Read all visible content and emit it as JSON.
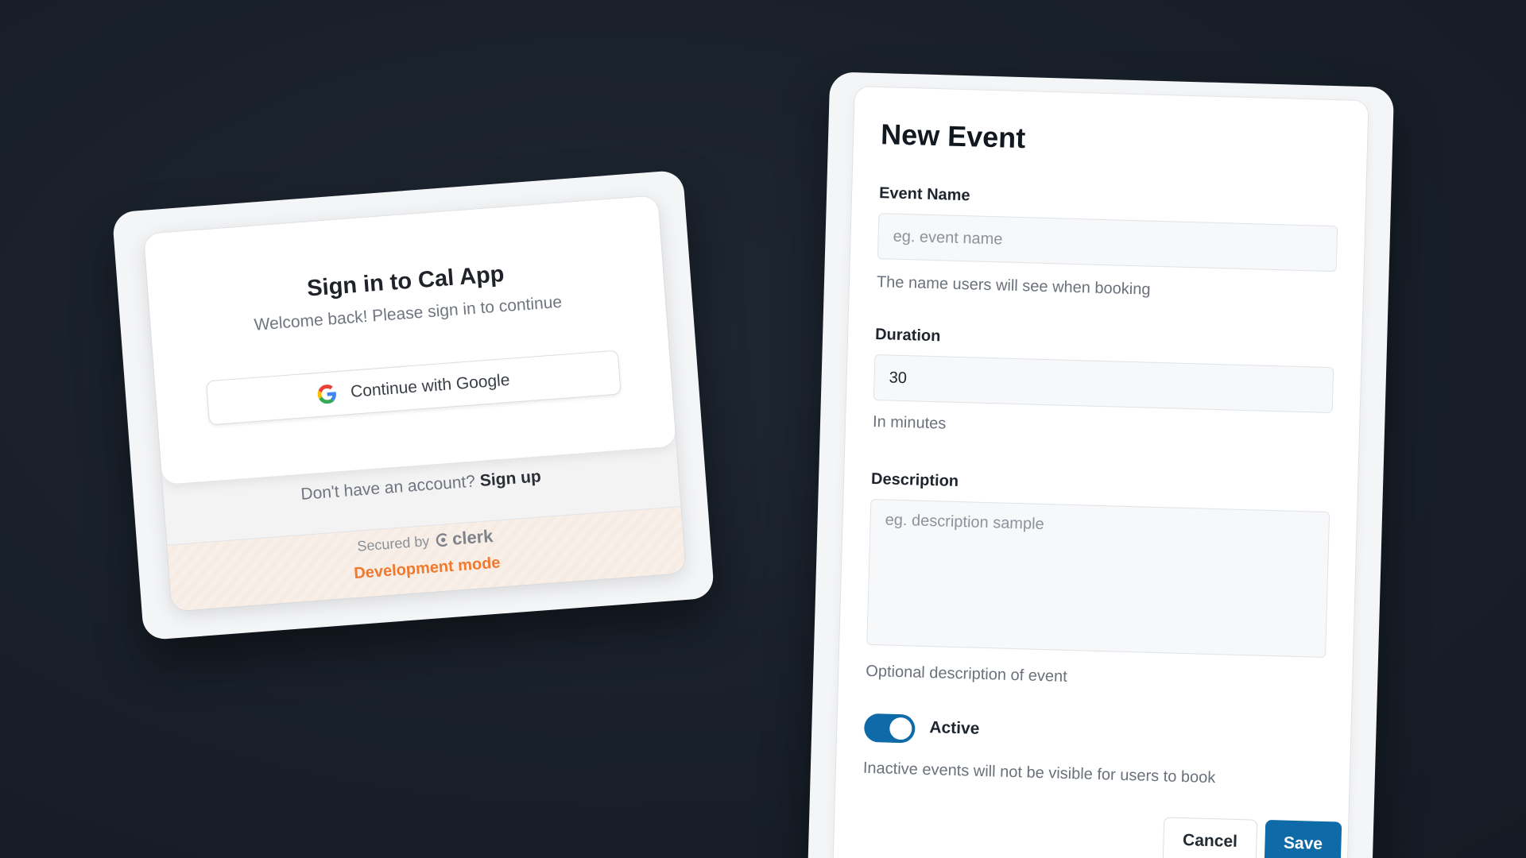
{
  "signin": {
    "title": "Sign in to Cal App",
    "subtitle": "Welcome back! Please sign in to continue",
    "google_button_label": "Continue with Google",
    "signup_prompt": "Don't have an account?",
    "signup_link": "Sign up",
    "secured_by": "Secured by",
    "provider_name": "clerk",
    "dev_mode": "Development mode"
  },
  "event_form": {
    "title": "New Event",
    "event_name": {
      "label": "Event Name",
      "placeholder": "eg. event name",
      "value": "",
      "help": "The name users will see when booking"
    },
    "duration": {
      "label": "Duration",
      "value": "30",
      "help": "In minutes"
    },
    "description": {
      "label": "Description",
      "placeholder": "eg. description sample",
      "value": "",
      "help": "Optional description of event"
    },
    "active_toggle": {
      "label": "Active",
      "on": true,
      "help": "Inactive events will not be visible for users to book"
    },
    "cancel_label": "Cancel",
    "save_label": "Save"
  },
  "colors": {
    "background": "#1b222c",
    "primary_button": "#0f6aa8",
    "dev_mode_orange": "#f1782c",
    "google_blue": "#4285F4",
    "google_red": "#EA4335",
    "google_yellow": "#FBBC05",
    "google_green": "#34A853"
  },
  "icons": {
    "google": "google-g-icon",
    "clerk": "clerk-logo-icon"
  }
}
